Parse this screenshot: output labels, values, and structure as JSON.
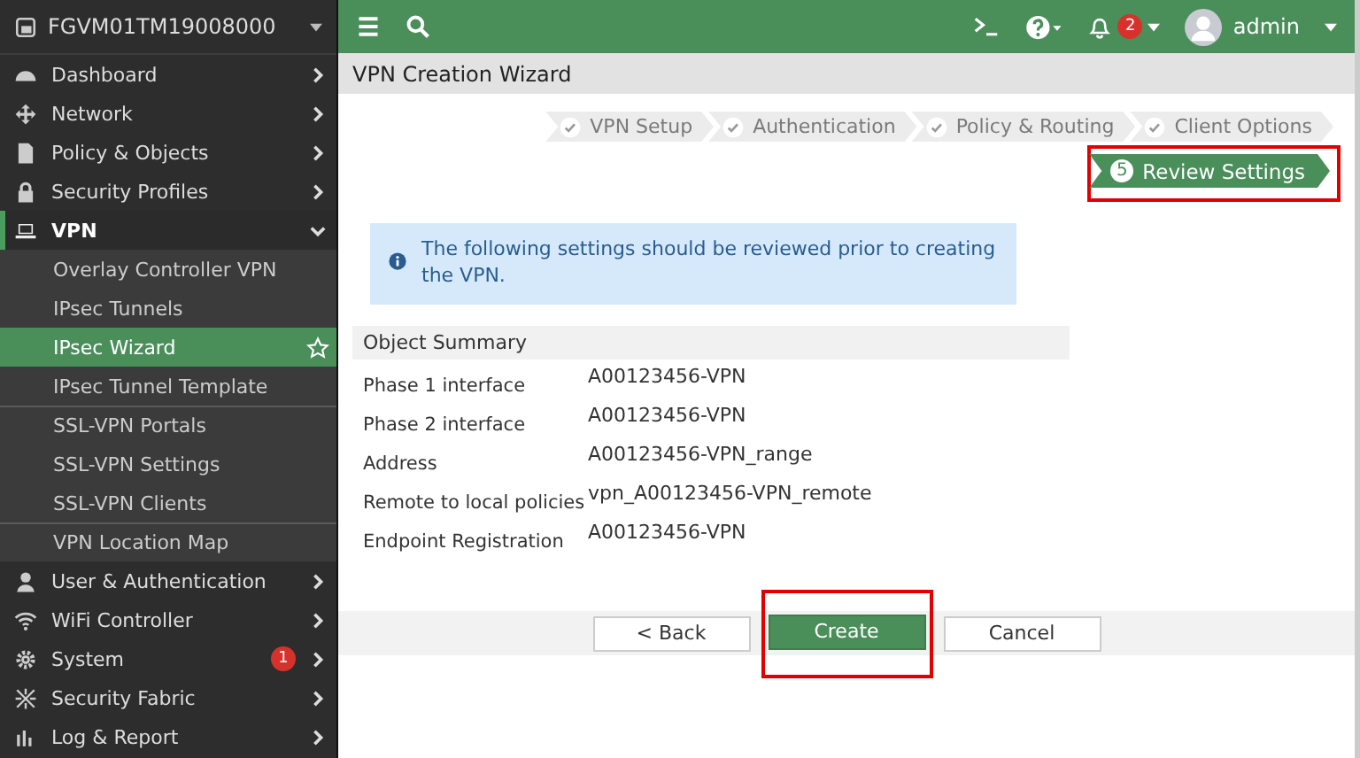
{
  "sidebar": {
    "device": "FGVM01TM19008000",
    "items": [
      {
        "label": "Dashboard",
        "expanded": false
      },
      {
        "label": "Network",
        "expanded": false
      },
      {
        "label": "Policy & Objects",
        "expanded": false
      },
      {
        "label": "Security Profiles",
        "expanded": false
      },
      {
        "label": "VPN",
        "expanded": true,
        "children": [
          {
            "label": "Overlay Controller VPN",
            "selected": false,
            "divider_above": false
          },
          {
            "label": "IPsec Tunnels",
            "selected": false,
            "divider_above": false
          },
          {
            "label": "IPsec Wizard",
            "selected": true,
            "divider_above": false
          },
          {
            "label": "IPsec Tunnel Template",
            "selected": false,
            "divider_above": false
          },
          {
            "label": "SSL-VPN Portals",
            "selected": false,
            "divider_above": true
          },
          {
            "label": "SSL-VPN Settings",
            "selected": false,
            "divider_above": false
          },
          {
            "label": "SSL-VPN Clients",
            "selected": false,
            "divider_above": false
          },
          {
            "label": "VPN Location Map",
            "selected": false,
            "divider_above": true
          }
        ]
      },
      {
        "label": "User & Authentication",
        "expanded": false
      },
      {
        "label": "WiFi Controller",
        "expanded": false
      },
      {
        "label": "System",
        "expanded": false,
        "badge": "1"
      },
      {
        "label": "Security Fabric",
        "expanded": false
      },
      {
        "label": "Log & Report",
        "expanded": false
      }
    ]
  },
  "topbar": {
    "notifications": "2",
    "user": "admin"
  },
  "page_title": "VPN Creation Wizard",
  "steps": [
    {
      "label": "VPN Setup",
      "kind": "done",
      "highlighted": false
    },
    {
      "label": "Authentication",
      "kind": "done",
      "highlighted": false
    },
    {
      "label": "Policy & Routing",
      "kind": "done",
      "highlighted": false
    },
    {
      "label": "Client Options",
      "kind": "done",
      "highlighted": false
    },
    {
      "label": "Review Settings",
      "kind": "current",
      "number": "5",
      "highlighted": true
    }
  ],
  "info": "The following settings should be reviewed prior to creating the VPN.",
  "summary": {
    "title": "Object Summary",
    "rows": [
      {
        "label": "Phase 1 interface",
        "value": "A00123456-VPN"
      },
      {
        "label": "Phase 2 interface",
        "value": "A00123456-VPN"
      },
      {
        "label": "Address",
        "value": "A00123456-VPN_range"
      },
      {
        "label": "Remote to local policies",
        "value": "vpn_A00123456-VPN_remote"
      },
      {
        "label": "Endpoint Registration",
        "value": "A00123456-VPN"
      }
    ]
  },
  "buttons": [
    {
      "label": "< Back",
      "kind": "secondary",
      "highlighted": false
    },
    {
      "label": "Create",
      "kind": "primary",
      "highlighted": true
    },
    {
      "label": "Cancel",
      "kind": "secondary",
      "highlighted": false
    }
  ]
}
